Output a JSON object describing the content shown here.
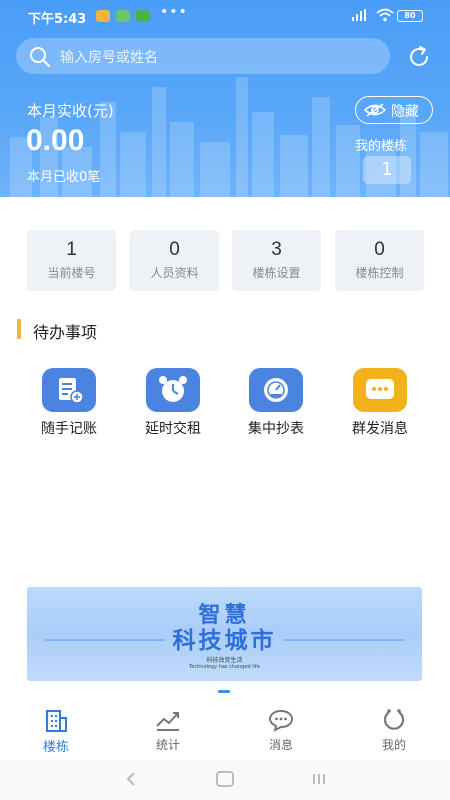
{
  "status_bar": {
    "time": "下午5:43",
    "battery": "80"
  },
  "search": {
    "placeholder": "输入房号或姓名"
  },
  "header": {
    "month_label": "本月实收(元)",
    "amount": "0.00",
    "received_text": "本月已收0笔",
    "hide_label": "隐藏",
    "my_building_label": "我的楼栋",
    "my_building_count": "1"
  },
  "stats": [
    {
      "value": "1",
      "label": "当前楼号"
    },
    {
      "value": "0",
      "label": "人员资料"
    },
    {
      "value": "3",
      "label": "楼栋设置"
    },
    {
      "value": "0",
      "label": "楼栋控制"
    }
  ],
  "section": {
    "title": "待办事项"
  },
  "actions": [
    {
      "label": "随手记账",
      "icon": "ledger-icon",
      "color": "#4a84e0"
    },
    {
      "label": "延时交租",
      "icon": "alarm-clock-icon",
      "color": "#4a84e0"
    },
    {
      "label": "集中抄表",
      "icon": "meter-icon",
      "color": "#4a84e0"
    },
    {
      "label": "群发消息",
      "icon": "message-icon",
      "color": "#f3b21c"
    }
  ],
  "banner": {
    "line1": "智慧",
    "line2": "科技城市",
    "line3": "科技改变生活",
    "line4": "Technology has changed life"
  },
  "tabs": [
    {
      "label": "楼栋",
      "icon": "building-icon",
      "active": true
    },
    {
      "label": "统计",
      "icon": "chart-icon",
      "active": false
    },
    {
      "label": "消息",
      "icon": "chat-icon",
      "active": false
    },
    {
      "label": "我的",
      "icon": "profile-icon",
      "active": false
    }
  ],
  "colors": {
    "primary": "#4a9df7",
    "accent": "#f0b43c",
    "tab_active": "#2e7dd9"
  }
}
